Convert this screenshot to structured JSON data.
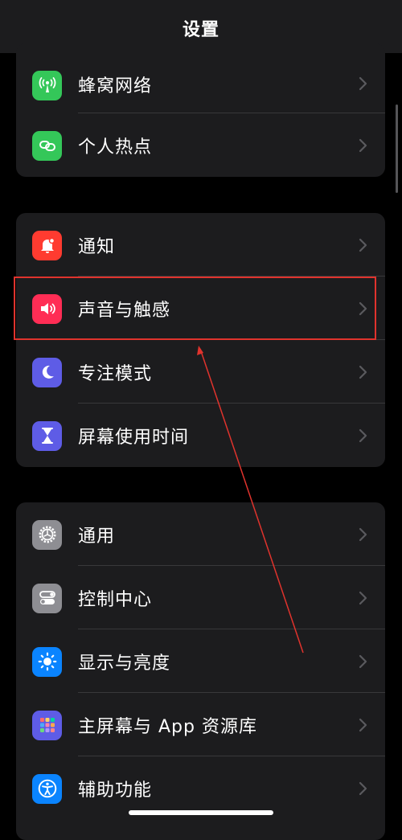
{
  "navbar": {
    "title": "设置"
  },
  "groups": [
    {
      "items": [
        {
          "label": "蜂窝网络",
          "icon": "antenna-icon",
          "color": "#34c759"
        },
        {
          "label": "个人热点",
          "icon": "link-icon",
          "color": "#34c759"
        }
      ]
    },
    {
      "items": [
        {
          "label": "通知",
          "icon": "bell-icon",
          "color": "#ff3b30"
        },
        {
          "label": "声音与触感",
          "icon": "speaker-icon",
          "color": "#ff2d55",
          "highlighted": true
        },
        {
          "label": "专注模式",
          "icon": "moon-icon",
          "color": "#5e5ce6"
        },
        {
          "label": "屏幕使用时间",
          "icon": "hourglass-icon",
          "color": "#5e5ce6"
        }
      ]
    },
    {
      "items": [
        {
          "label": "通用",
          "icon": "gear-icon",
          "color": "#8e8e93"
        },
        {
          "label": "控制中心",
          "icon": "toggles-icon",
          "color": "#8e8e93"
        },
        {
          "label": "显示与亮度",
          "icon": "sun-icon",
          "color": "#0a84ff"
        },
        {
          "label": "主屏幕与 App 资源库",
          "icon": "app-grid-icon",
          "color": "#5e5ce6"
        },
        {
          "label": "辅助功能",
          "icon": "accessibility-icon",
          "color": "#0a84ff"
        }
      ]
    }
  ],
  "annotation": {
    "color": "#e0332d"
  }
}
